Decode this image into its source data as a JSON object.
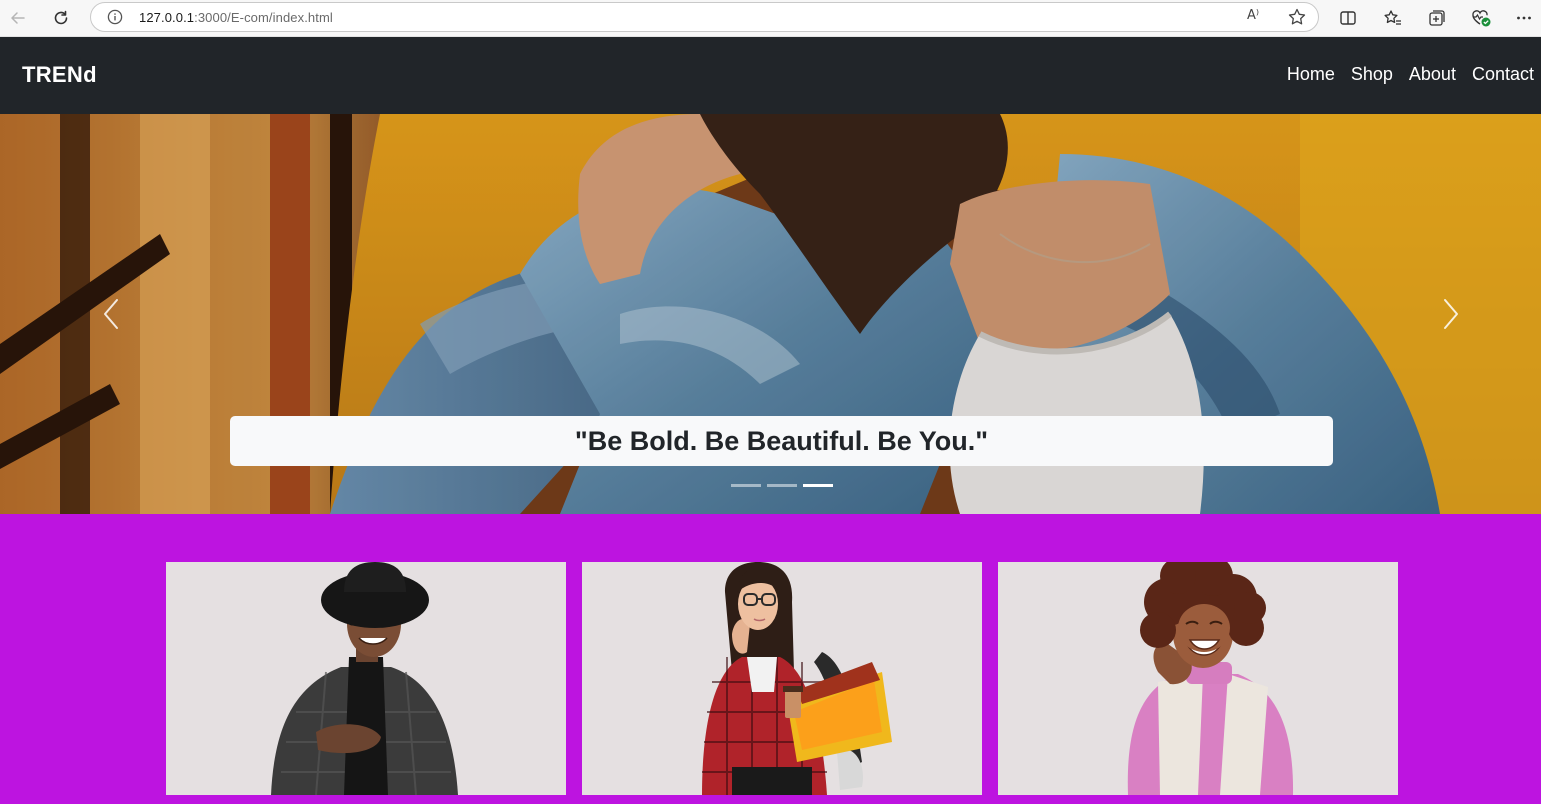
{
  "browser": {
    "url_host": "127.0.0.1",
    "url_rest": ":3000/E-com/index.html",
    "read_aloud_label": "A⁾"
  },
  "navbar": {
    "brand": "TRENd",
    "links": [
      "Home",
      "Shop",
      "About",
      "Contact"
    ],
    "background": "#212529"
  },
  "hero": {
    "caption": "\"Be Bold. Be Beautiful. Be You.\"",
    "slide_count": 3,
    "active_slide": 3
  },
  "products": {
    "background": "#bd14e0",
    "cards": [
      {
        "subject": "man-in-hat-and-blazer"
      },
      {
        "subject": "woman-with-glasses-and-folders"
      },
      {
        "subject": "smiling-woman-curly-hair"
      }
    ]
  }
}
